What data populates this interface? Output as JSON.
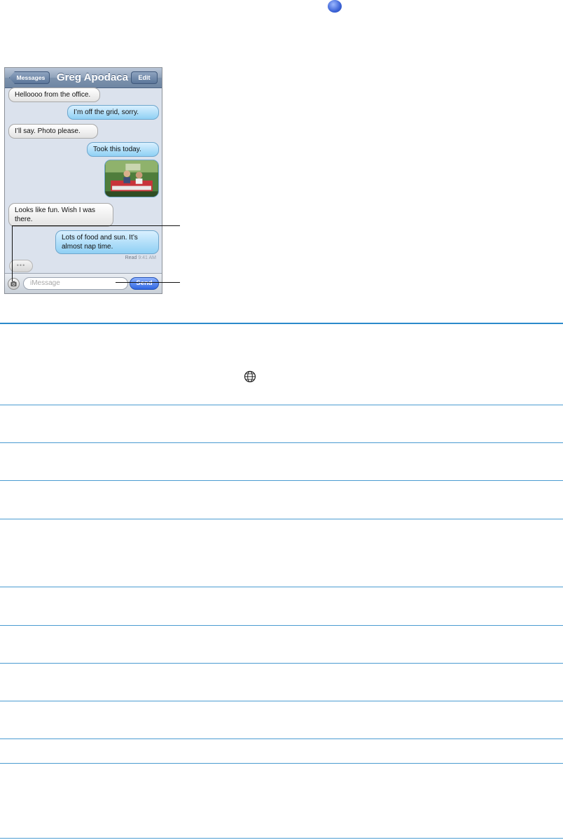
{
  "nav": {
    "back_label": "Messages",
    "title": "Greg Apodaca",
    "edit_label": "Edit"
  },
  "messages": [
    {
      "direction": "in",
      "text": "Helloooo from the office."
    },
    {
      "direction": "out",
      "text": "I’m off the grid, sorry."
    },
    {
      "direction": "in",
      "text": "I’ll say. Photo please."
    },
    {
      "direction": "out",
      "text": "Took this today."
    },
    {
      "direction": "out",
      "type": "photo"
    },
    {
      "direction": "in",
      "text": "Looks like fun. Wish I was there."
    },
    {
      "direction": "out",
      "text": "Lots of food and sun. It’s almost nap time."
    }
  ],
  "read_receipt": {
    "label": "Read",
    "time": "9:41 AM"
  },
  "typing_indicator": "•••",
  "composer": {
    "placeholder": "iMessage",
    "send_label": "Send"
  },
  "icons": {
    "top_marker": "blue-circle-icon",
    "camera": "camera-icon",
    "globe": "globe-icon"
  },
  "colors": {
    "rule": "#4a9bd1",
    "outgoing_bubble": "#8fd0f4",
    "incoming_bubble": "#e3e3e3",
    "send_button": "#2f66e1"
  }
}
